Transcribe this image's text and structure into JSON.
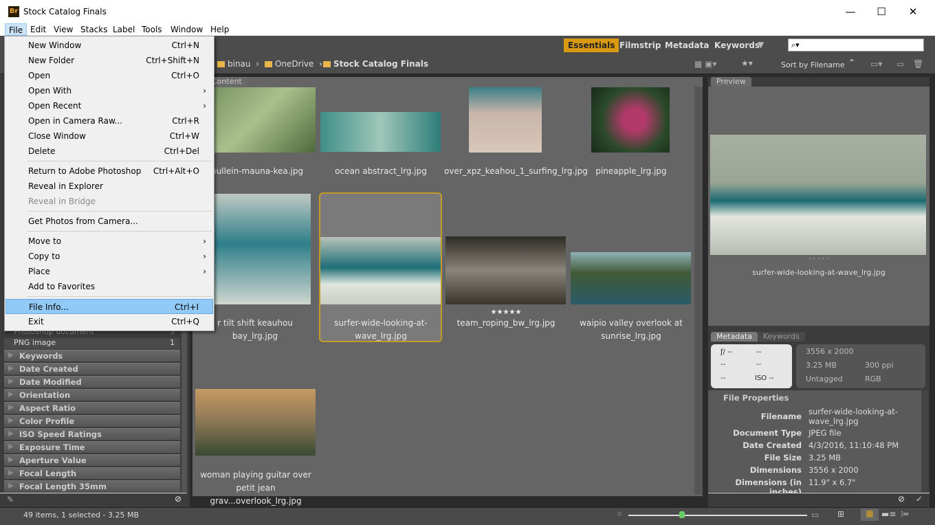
{
  "window": {
    "title": "Stock Catalog Finals",
    "app_icon": "Br",
    "controls": [
      "minimize",
      "maximize",
      "close"
    ]
  },
  "menubar": [
    "File",
    "Edit",
    "View",
    "Stacks",
    "Label",
    "Tools",
    "Window",
    "Help"
  ],
  "file_menu": [
    {
      "label": "New Window",
      "shortcut": "Ctrl+N"
    },
    {
      "label": "New Folder",
      "shortcut": "Ctrl+Shift+N"
    },
    {
      "label": "Open",
      "shortcut": "Ctrl+O"
    },
    {
      "label": "Open With",
      "submenu": true
    },
    {
      "label": "Open Recent",
      "submenu": true
    },
    {
      "label": "Open in Camera Raw...",
      "shortcut": "Ctrl+R"
    },
    {
      "label": "Close Window",
      "shortcut": "Ctrl+W"
    },
    {
      "label": "Delete",
      "shortcut": "Ctrl+Del"
    },
    {
      "label": "Return to Adobe Photoshop",
      "shortcut": "Ctrl+Alt+O"
    },
    {
      "label": "Reveal in Explorer"
    },
    {
      "label": "Reveal in Bridge",
      "disabled": true
    },
    {
      "label": "Get Photos from Camera..."
    },
    {
      "label": "Move to",
      "submenu": true
    },
    {
      "label": "Copy to",
      "submenu": true
    },
    {
      "label": "Place",
      "submenu": true
    },
    {
      "label": "Add to Favorites"
    },
    {
      "label": "File Info...",
      "shortcut": "Ctrl+I",
      "highlighted": true
    },
    {
      "label": "Exit",
      "shortcut": "Ctrl+Q"
    }
  ],
  "workspaces": {
    "active": "Essentials",
    "items": [
      "Essentials",
      "Filmstrip",
      "Metadata",
      "Keywords"
    ]
  },
  "search": {
    "placeholder": "⌕▾"
  },
  "breadcrumb": [
    "binau",
    "OneDrive",
    "Stock Catalog Finals"
  ],
  "sort": {
    "label": "Sort by Filename"
  },
  "content_tab": "Content",
  "filter": {
    "rows": [
      {
        "label": "Photoshop document",
        "count": "3"
      },
      {
        "label": "PNG image",
        "count": "1"
      }
    ],
    "categories": [
      "Keywords",
      "Date Created",
      "Date Modified",
      "Orientation",
      "Aspect Ratio",
      "Color Profile",
      "ISO Speed Ratings",
      "Exposure Time",
      "Aperture Value",
      "Focal Length",
      "Focal Length 35mm"
    ]
  },
  "thumbnails": [
    {
      "name": "mullein-mauna-kea.jpg"
    },
    {
      "name": "ocean abstract_lrg.jpg"
    },
    {
      "name": "over_xpz_keahou_1_surfing_lrg.jpg"
    },
    {
      "name": "pineapple_lrg.jpg"
    },
    {
      "name": "r tilt shift keauhou bay_lrg.jpg"
    },
    {
      "name": "surfer-wide-looking-at-wave_lrg.jpg",
      "selected": true
    },
    {
      "name": "team_roping_bw_lrg.jpg",
      "rating": "★★★★★"
    },
    {
      "name": "waipio valley overlook at sunrise_lrg.jpg"
    },
    {
      "name": "woman playing guitar over petit jean grav...overlook_lrg.jpg"
    }
  ],
  "preview": {
    "tab": "Preview",
    "caption": "surfer-wide-looking-at-wave_lrg.jpg",
    "dots": "· · · · ·"
  },
  "metadata": {
    "tabs": [
      "Metadata",
      "Keywords"
    ],
    "camera": [
      "ƒ/ --",
      "--",
      "--",
      "--",
      "--",
      "ISO --"
    ],
    "summary": {
      "dimensions": "3556 x 2000",
      "size": "3.25 MB",
      "ppi": "300 ppi",
      "profile": "Untagged",
      "mode": "RGB"
    },
    "section": "File Properties",
    "fields": [
      {
        "key": "Filename",
        "value": "surfer-wide-looking-at-wave_lrg.jpg"
      },
      {
        "key": "Document Type",
        "value": "JPEG file"
      },
      {
        "key": "Date Created",
        "value": "4/3/2016, 11:10:48 PM"
      },
      {
        "key": "File Size",
        "value": "3.25 MB"
      },
      {
        "key": "Dimensions",
        "value": "3556 x 2000"
      },
      {
        "key": "Dimensions (in inches)",
        "value": "11.9\" x 6.7\""
      }
    ]
  },
  "status": {
    "text": "49 items, 1 selected - 3.25 MB",
    "thumbnail_size": 0.3
  }
}
